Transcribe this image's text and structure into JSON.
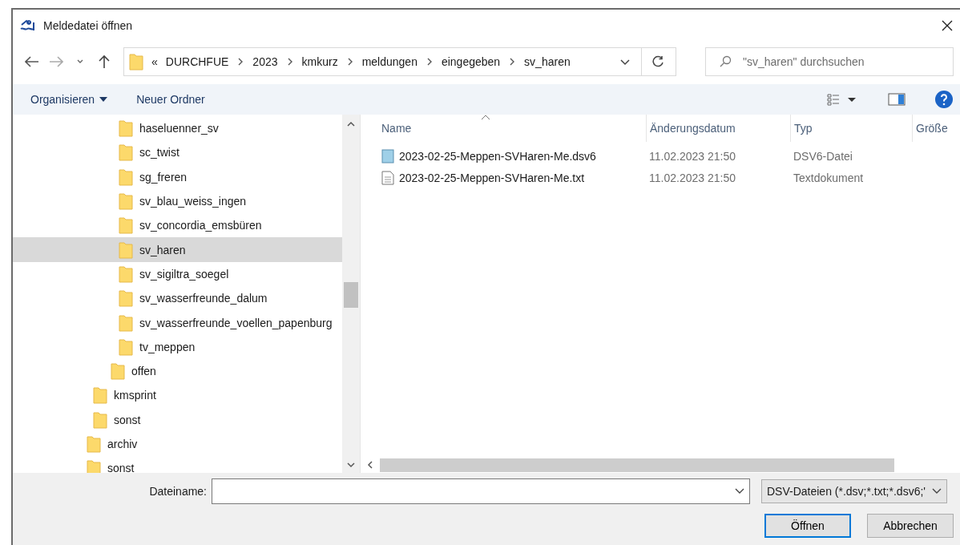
{
  "window": {
    "title": "Meldedatei öffnen"
  },
  "address": {
    "prefix": "«",
    "segments": [
      "DURCHFUE",
      "2023",
      "kmkurz",
      "meldungen",
      "eingegeben",
      "sv_haren"
    ]
  },
  "search": {
    "placeholder": "\"sv_haren\" durchsuchen"
  },
  "toolbar": {
    "organize": "Organisieren",
    "new_folder": "Neuer Ordner"
  },
  "tree": [
    {
      "children": [
        {
          "children": [
            {
              "children": [
                {
                  "name": "haseluenner_sv",
                  "selected": false
                },
                {
                  "name": "sc_twist",
                  "selected": false
                },
                {
                  "name": "sg_freren",
                  "selected": false
                },
                {
                  "name": "sv_blau_weiss_ingen",
                  "selected": false
                },
                {
                  "name": "sv_concordia_emsbüren",
                  "selected": false
                },
                {
                  "name": "sv_haren",
                  "selected": true
                },
                {
                  "name": "sv_sigiltra_soegel",
                  "selected": false
                },
                {
                  "name": "sv_wasserfreunde_dalum",
                  "selected": false
                },
                {
                  "name": "sv_wasserfreunde_voellen_papenburg",
                  "selected": false
                },
                {
                  "name": "tv_meppen",
                  "selected": false
                }
              ]
            },
            {
              "name": "offen",
              "selected": false
            }
          ]
        },
        {
          "name": "kmsprint",
          "selected": false
        },
        {
          "name": "sonst",
          "selected": false
        }
      ]
    },
    {
      "name": "archiv",
      "selected": false
    },
    {
      "name": "sonst",
      "selected": false
    }
  ],
  "table": {
    "columns": [
      "Name",
      "Änderungsdatum",
      "Typ",
      "Größe"
    ],
    "rows": [
      {
        "kind": "dsv",
        "name": "2023-02-25-Meppen-SVHaren-Me.dsv6",
        "date": "11.02.2023 21:50",
        "type": "DSV6-Datei"
      },
      {
        "kind": "text",
        "name": "2023-02-25-Meppen-SVHaren-Me.txt",
        "date": "11.02.2023 21:50",
        "type": "Textdokument"
      }
    ]
  },
  "filename": {
    "label": "Dateiname:"
  },
  "filter": {
    "value": "DSV-Dateien (*.dsv;*.txt;*.dsv6;'"
  },
  "buttons": [
    "Öffnen",
    "Abbrechen"
  ]
}
